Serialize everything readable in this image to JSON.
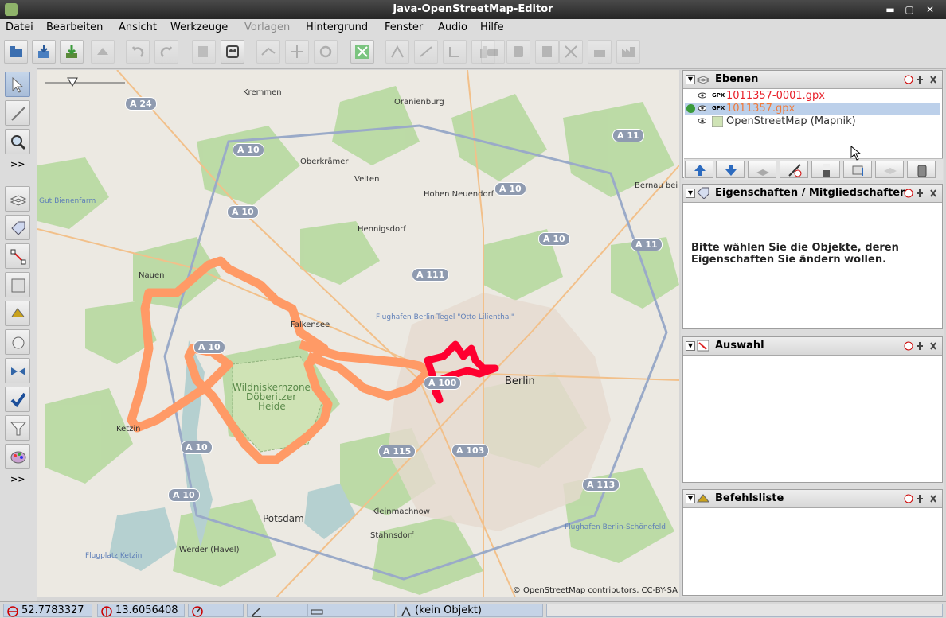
{
  "window": {
    "title": "Java-OpenStreetMap-Editor"
  },
  "menu": [
    "Datei",
    "Bearbeiten",
    "Ansicht",
    "Werkzeuge",
    "Vorlagen",
    "Hintergrund",
    "Fenster",
    "Audio",
    "Hilfe"
  ],
  "map": {
    "places": [
      "Kremmen",
      "Oranienburg",
      "Oberkrämer",
      "Velten",
      "Hohen Neuendorf",
      "Hennigsdorf",
      "Nauen",
      "Falkensee",
      "Berlin",
      "Potsdam",
      "Kleinmachnow",
      "Stahnsdorf",
      "Werder (Havel)",
      "Bernau bei Berlin",
      "Ketzin"
    ],
    "nature_reserve": [
      "Wildniskernzone",
      "Döberitzer",
      "Heide"
    ],
    "shields": [
      "A 24",
      "A 10",
      "A 10",
      "A 10",
      "A 10",
      "A 11",
      "A 11",
      "A 111",
      "A 10",
      "A 10",
      "A 100",
      "A 115",
      "A 103",
      "A 113",
      "A 10"
    ],
    "airports": [
      "Flughafen Berlin-Tegel \"Otto Lilienthal\"",
      "Flughafen Berlin-Schönefeld",
      "Flugplatz Ketzin"
    ],
    "misc_labels": [
      "Gut Bienenfarm"
    ],
    "copyright": "© OpenStreetMap contributors, CC-BY-SA",
    "track_colors": {
      "orange": "#ff9a66",
      "red": "#ff0030"
    }
  },
  "layers_panel": {
    "title": "Ebenen",
    "layers": [
      {
        "name": "1011357-0001.gpx",
        "color": "#e8202a",
        "type": "GPX"
      },
      {
        "name": "1011357.gpx",
        "color": "#f07a3a",
        "type": "GPX",
        "active": true
      },
      {
        "name": "OpenStreetMap (Mapnik)",
        "color": "#333333"
      }
    ]
  },
  "properties_panel": {
    "title": "Eigenschaften / Mitgliedschaften",
    "empty_line1": "Bitte wählen Sie die Objekte, deren",
    "empty_line2": "Eigenschaften Sie ändern wollen."
  },
  "selection_panel": {
    "title": "Auswahl"
  },
  "commands_panel": {
    "title": "Befehlsliste"
  },
  "left_toolbar": {
    "more1": ">>",
    "more2": ">>"
  },
  "status": {
    "lat": "52.7783327",
    "lon": "13.6056408",
    "object": "(kein Objekt)"
  }
}
